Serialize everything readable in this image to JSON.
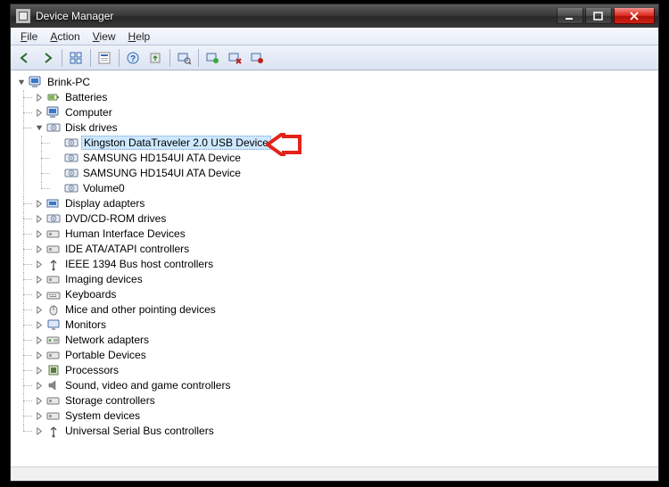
{
  "window": {
    "title": "Device Manager"
  },
  "menus": {
    "file": "File",
    "action": "Action",
    "view": "View",
    "help": "Help"
  },
  "toolbar_icons": {
    "back": "back-arrow-icon",
    "forward": "forward-arrow-icon",
    "show_hidden": "show-hidden-icon",
    "properties": "properties-icon",
    "help": "help-icon",
    "update_driver": "update-driver-icon",
    "scan": "scan-hardware-icon",
    "enable": "enable-device-icon",
    "uninstall": "uninstall-icon",
    "disable": "disable-device-icon"
  },
  "tree": {
    "root": "Brink-PC",
    "items": [
      "Batteries",
      "Computer",
      "Disk drives",
      "Display adapters",
      "DVD/CD-ROM drives",
      "Human Interface Devices",
      "IDE ATA/ATAPI controllers",
      "IEEE 1394 Bus host controllers",
      "Imaging devices",
      "Keyboards",
      "Mice and other pointing devices",
      "Monitors",
      "Network adapters",
      "Portable Devices",
      "Processors",
      "Sound, video and game controllers",
      "Storage controllers",
      "System devices",
      "Universal Serial Bus controllers"
    ],
    "disk_drives": {
      "children": [
        "Kingston DataTraveler 2.0 USB Device",
        "SAMSUNG HD154UI ATA Device",
        "SAMSUNG HD154UI ATA Device",
        "Volume0"
      ],
      "selected_index": 0
    }
  }
}
